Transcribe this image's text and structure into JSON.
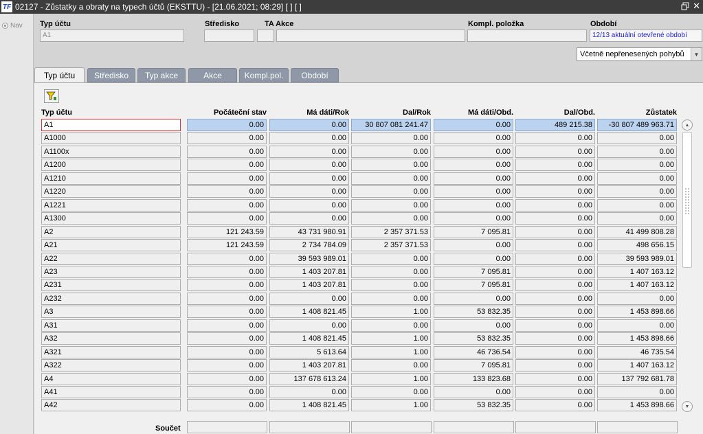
{
  "window": {
    "title": "02127 - Zůstatky a obraty na typech účtů (EKSTTU) - [21.06.2021; 08:29]  [ ]  [ ]",
    "app_icon": "TF"
  },
  "nav": {
    "label": "Nav"
  },
  "header": {
    "typ_uctu": {
      "label": "Typ účtu",
      "value": "A1"
    },
    "stredisko": {
      "label": "Středisko",
      "value": ""
    },
    "ta_akce": {
      "label": "TA Akce",
      "value": ""
    },
    "kompl_polozka": {
      "label": "Kompl. položka",
      "value": ""
    },
    "obdobi": {
      "label": "Období",
      "value": "12/13 aktuální otevřené období"
    },
    "select_value": "Včetně nepřenesených pohybů"
  },
  "tabs": [
    {
      "label": "Typ účtu"
    },
    {
      "label": "Středisko"
    },
    {
      "label": "Typ akce"
    },
    {
      "label": "Akce"
    },
    {
      "label": "Kompl.pol."
    },
    {
      "label": "Období"
    }
  ],
  "table": {
    "columns": [
      "Typ účtu",
      "Počáteční stav",
      "Má dáti/Rok",
      "Dal/Rok",
      "Má dáti/Obd.",
      "Dal/Obd.",
      "Zůstatek"
    ],
    "rows": [
      [
        "A1",
        "0.00",
        "0.00",
        "30 807 081 241.47",
        "0.00",
        "489 215.38",
        "-30 807 489 963.71"
      ],
      [
        "A1000",
        "0.00",
        "0.00",
        "0.00",
        "0.00",
        "0.00",
        "0.00"
      ],
      [
        "A1100x",
        "0.00",
        "0.00",
        "0.00",
        "0.00",
        "0.00",
        "0.00"
      ],
      [
        "A1200",
        "0.00",
        "0.00",
        "0.00",
        "0.00",
        "0.00",
        "0.00"
      ],
      [
        "A1210",
        "0.00",
        "0.00",
        "0.00",
        "0.00",
        "0.00",
        "0.00"
      ],
      [
        "A1220",
        "0.00",
        "0.00",
        "0.00",
        "0.00",
        "0.00",
        "0.00"
      ],
      [
        "A1221",
        "0.00",
        "0.00",
        "0.00",
        "0.00",
        "0.00",
        "0.00"
      ],
      [
        "A1300",
        "0.00",
        "0.00",
        "0.00",
        "0.00",
        "0.00",
        "0.00"
      ],
      [
        "A2",
        "121 243.59",
        "43 731 980.91",
        "2 357 371.53",
        "7 095.81",
        "0.00",
        "41 499 808.28"
      ],
      [
        "A21",
        "121 243.59",
        "2 734 784.09",
        "2 357 371.53",
        "0.00",
        "0.00",
        "498 656.15"
      ],
      [
        "A22",
        "0.00",
        "39 593 989.01",
        "0.00",
        "0.00",
        "0.00",
        "39 593 989.01"
      ],
      [
        "A23",
        "0.00",
        "1 403 207.81",
        "0.00",
        "7 095.81",
        "0.00",
        "1 407 163.12"
      ],
      [
        "A231",
        "0.00",
        "1 403 207.81",
        "0.00",
        "7 095.81",
        "0.00",
        "1 407 163.12"
      ],
      [
        "A232",
        "0.00",
        "0.00",
        "0.00",
        "0.00",
        "0.00",
        "0.00"
      ],
      [
        "A3",
        "0.00",
        "1 408 821.45",
        "1.00",
        "53 832.35",
        "0.00",
        "1 453 898.66"
      ],
      [
        "A31",
        "0.00",
        "0.00",
        "0.00",
        "0.00",
        "0.00",
        "0.00"
      ],
      [
        "A32",
        "0.00",
        "1 408 821.45",
        "1.00",
        "53 832.35",
        "0.00",
        "1 453 898.66"
      ],
      [
        "A321",
        "0.00",
        "5 613.64",
        "1.00",
        "46 736.54",
        "0.00",
        "46 735.54"
      ],
      [
        "A322",
        "0.00",
        "1 403 207.81",
        "0.00",
        "7 095.81",
        "0.00",
        "1 407 163.12"
      ],
      [
        "A4",
        "0.00",
        "137 678 613.24",
        "1.00",
        "133 823.68",
        "0.00",
        "137 792 681.78"
      ],
      [
        "A41",
        "0.00",
        "0.00",
        "0.00",
        "0.00",
        "0.00",
        "0.00"
      ],
      [
        "A42",
        "0.00",
        "1 408 821.45",
        "1.00",
        "53 832.35",
        "0.00",
        "1 453 898.66"
      ]
    ],
    "selected_row": 0
  },
  "footer": {
    "sum_label": "Součet"
  },
  "colors": {
    "tab_inactive": "#8e98a6",
    "selected_cell": "#bcd3ef",
    "focus_border": "#d43838",
    "obdobi_text": "#2222c8"
  }
}
